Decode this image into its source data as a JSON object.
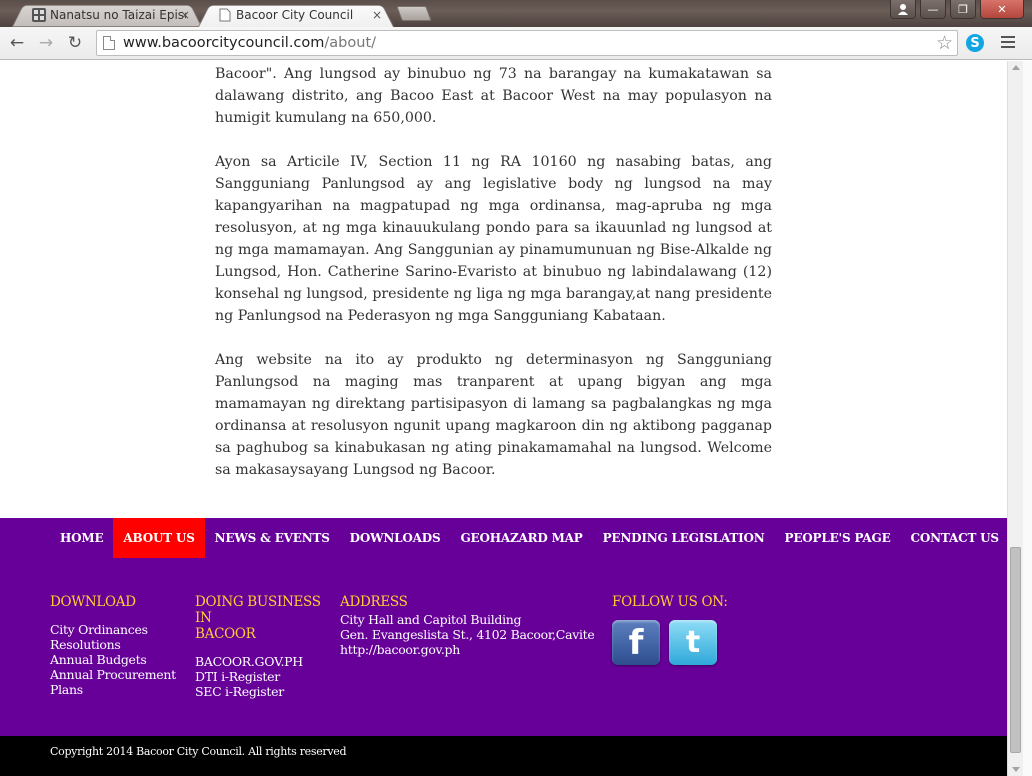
{
  "browser": {
    "tabs": [
      {
        "title": "Nanatsu no Taizai Episode",
        "active": false,
        "close": "×"
      },
      {
        "title": "Bacoor City Council",
        "active": true,
        "close": "×"
      }
    ],
    "url": {
      "host": "www.bacoorcitycouncil.com",
      "path": "/about/"
    },
    "nav": {
      "back": "←",
      "forward": "→",
      "reload": "↻",
      "star": "☆"
    },
    "skype_letter": "S",
    "window": {
      "minimize": "—",
      "maximize": "❐",
      "close": "✕",
      "user": "👤"
    }
  },
  "content": {
    "paragraphs": [
      "Bacoor\". Ang lungsod ay binubuo ng 73 na barangay na kumakatawan sa dalawang distrito, ang Bacoo East at Bacoor West na may populasyon na humigit kumulang na 650,000.",
      "Ayon sa Articile IV, Section 11 ng RA 10160 ng nasabing batas, ang Sangguniang Panlungsod ay ang legislative body ng lungsod na may kapangyarihan na magpatupad ng mga ordinansa, mag-apruba ng mga resolusyon, at ng mga kinauukulang pondo para sa ikauunlad ng lungsod at ng mga mamamayan. Ang Sanggunian ay pinamumunuan ng Bise-Alkalde ng Lungsod, Hon. Catherine Sarino-Evaristo at binubuo ng labindalawang (12) konsehal ng lungsod, presidente ng liga ng mga barangay,at nang presidente ng Panlungsod na Pederasyon ng mga Sangguniang Kabataan.",
      "Ang website na ito ay produkto ng determinasyon ng Sangguniang Panlungsod na maging mas tranparent at upang bigyan ang mga mamamayan ng direktang partisipasyon di lamang sa pagbalangkas ng mga ordinansa at resolusyon ngunit upang magkaroon din ng aktibong pagganap sa paghubog sa kinabukasan ng ating pinakamamahal na lungsod. Welcome sa makasaysayang Lungsod ng Bacoor."
    ]
  },
  "footer": {
    "nav": [
      {
        "label": "HOME",
        "active": false
      },
      {
        "label": "ABOUT US",
        "active": true
      },
      {
        "label": "NEWS & EVENTS",
        "active": false
      },
      {
        "label": "DOWNLOADS",
        "active": false
      },
      {
        "label": "GEOHAZARD MAP",
        "active": false
      },
      {
        "label": "PENDING LEGISLATION",
        "active": false
      },
      {
        "label": "PEOPLE'S PAGE",
        "active": false
      },
      {
        "label": "CONTACT US",
        "active": false
      }
    ],
    "download": {
      "heading": "DOWNLOAD",
      "links": [
        "City Ordinances",
        "Resolutions",
        "Annual Budgets",
        "Annual Procurement",
        "Plans"
      ]
    },
    "business": {
      "heading_line1": "DOING BUSINESS IN",
      "heading_line2": "BACOOR",
      "links": [
        "BACOOR.GOV.PH",
        "DTI i-Register",
        "SEC i-Register"
      ]
    },
    "address": {
      "heading": "ADDRESS",
      "lines": [
        "City Hall and Capitol Building",
        "Gen. Evangeslista St., 4102 Bacoor,Cavite",
        "http://bacoor.gov.ph"
      ]
    },
    "follow": {
      "heading": "FOLLOW US ON:",
      "facebook_glyph": "f",
      "twitter_glyph": "t"
    },
    "copyright": "Copyright 2014 Bacoor City Council. All rights reserved"
  },
  "colors": {
    "footer_bg": "#660099",
    "active_nav": "#ff0000",
    "heading_accent": "#ffcc33",
    "copyright_bg": "#000000"
  }
}
